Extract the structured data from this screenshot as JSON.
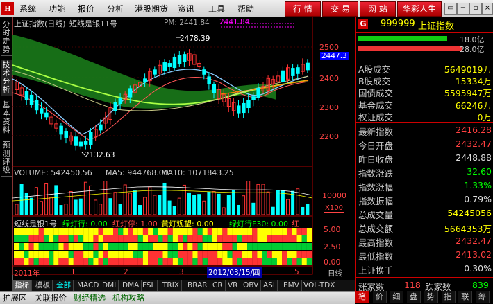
{
  "menu": {
    "logo": "H",
    "items": [
      "系统",
      "功能",
      "报价",
      "分析",
      "港股期货",
      "资讯",
      "工具",
      "帮助"
    ],
    "right_buttons": [
      "行 情",
      "交 易",
      "网 站",
      "华彩人生"
    ],
    "window_controls": [
      "▭",
      "−",
      "▫",
      "×"
    ]
  },
  "left_tabs": [
    "分时走势",
    "技术分析",
    "基本资料",
    "预测评级"
  ],
  "chart": {
    "title": "上证指数(日线)",
    "indicator_name": "短线是银11号",
    "pm_label": "PM: 2441.84",
    "pm_value_box": "2441.84",
    "price_box": "2447.3",
    "peak_label": "2478.39",
    "low_label": "2132.63",
    "y_ticks": [
      "2500",
      "2400",
      "2300",
      "2200"
    ],
    "volume_label": "VOLUME: 542450.56",
    "ma5_label": "MA5: 944768.00",
    "ma10_label": "MA10: 1071843.25",
    "vol_tick": "10000",
    "vol_unit": "X100",
    "ind_label": "短线是银1号",
    "ind_green": "绿灯行: 0.00",
    "ind_red": "红灯停: 1.00",
    "ind_yellow": "黄灯观望: 0.00",
    "ind_green_f30": "绿灯行F30: 0.00",
    "ind_tail": "红",
    "ind_ticks": [
      "5.00",
      "2.50",
      "0.00"
    ],
    "x_labels": [
      "2011年",
      "1",
      "2",
      "3",
      "5"
    ],
    "x_date": "2012/03/15/四",
    "period": "日线"
  },
  "bottom_tabs": [
    "指标",
    "模板",
    "全部",
    "MACD",
    "DMI",
    "DMA",
    "FSL",
    "TRIX",
    "BRAR",
    "CR",
    "VR",
    "OBV",
    "ASI",
    "EMV",
    "VOL-TDX"
  ],
  "status_tabs": [
    "扩展区",
    "关联报价",
    "财经精选",
    "机构攻略"
  ],
  "right_panel": {
    "badge": "G",
    "code": "999999",
    "name": "上证指数",
    "bar1_label": "18.0亿",
    "bar2_label": "28.0亿",
    "rows_a": [
      {
        "label": "A股成交",
        "value": "5649019万"
      },
      {
        "label": "B股成交",
        "value": "15334万"
      },
      {
        "label": "国债成交",
        "value": "5595947万"
      },
      {
        "label": "基金成交",
        "value": "66246万"
      },
      {
        "label": "权证成交",
        "value": "0万"
      }
    ],
    "rows_b": [
      {
        "label": "最新指数",
        "value": "2416.28",
        "color": "#ff4040"
      },
      {
        "label": "今日开盘",
        "value": "2432.47",
        "color": "#ff4040"
      },
      {
        "label": "昨日收盘",
        "value": "2448.88",
        "color": "#dddddd"
      },
      {
        "label": "指数涨跌",
        "value": "-32.60",
        "color": "#00ff00"
      },
      {
        "label": "指数涨幅",
        "value": "-1.33%",
        "color": "#00ff00"
      },
      {
        "label": "指数振幅",
        "value": "0.79%",
        "color": "#dddddd"
      },
      {
        "label": "总成交量",
        "value": "54245056",
        "color": "#ffff00"
      },
      {
        "label": "总成交额",
        "value": "5664353万",
        "color": "#ffff00"
      },
      {
        "label": "最高指数",
        "value": "2432.47",
        "color": "#ff4040"
      },
      {
        "label": "最低指数",
        "value": "2413.02",
        "color": "#ff4040"
      },
      {
        "label": "上证换手",
        "value": "0.30%",
        "color": "#dddddd"
      }
    ],
    "up_label": "涨家数",
    "up_value": "118",
    "down_label": "跌家数",
    "down_value": "839",
    "bottom_tabs": [
      "笔",
      "价",
      "细",
      "盘",
      "势",
      "指",
      "联",
      "筹"
    ]
  },
  "colors": {
    "up": "#ff3030",
    "down": "#00ffff",
    "accent": "#c00000"
  }
}
